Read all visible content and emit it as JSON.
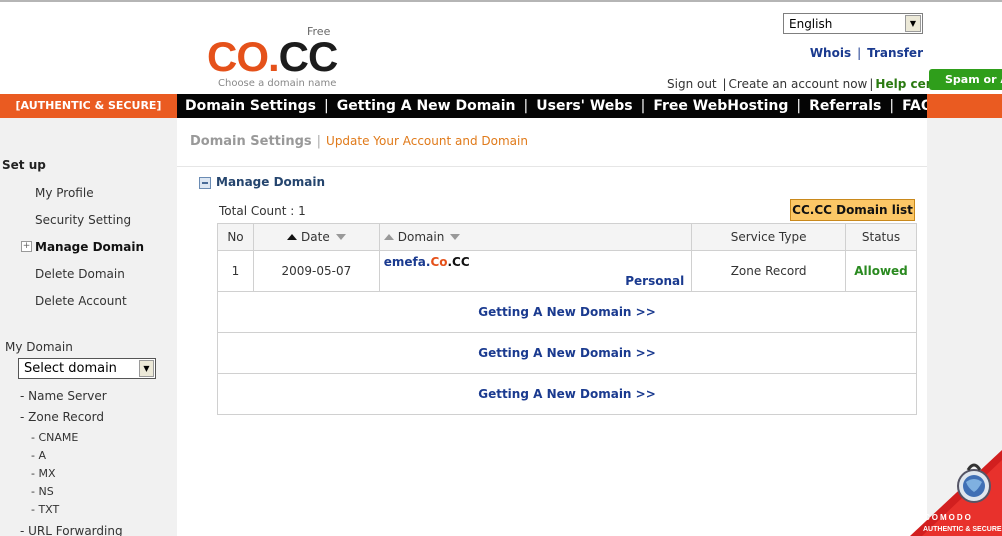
{
  "header": {
    "logo_free": "Free",
    "logo_co": "CO",
    "logo_dot": ".",
    "logo_cc": "CC",
    "logo_tagline": "Choose a domain name",
    "language": "English",
    "whois": "Whois",
    "transfer": "Transfer",
    "top_sep": "|",
    "sign_out": "Sign out",
    "create_account": "Create an account now",
    "help_center": "Help center",
    "account_sep": "|",
    "spam_badge": "Spam or A"
  },
  "nav": {
    "authentic": "[AUTHENTIC & SECURE]",
    "sep": "|",
    "items": [
      "Domain Settings",
      "Getting A New Domain",
      "Users' Webs",
      "Free WebHosting",
      "Referrals",
      "FAQ"
    ]
  },
  "sidebar": {
    "setup": "Set up",
    "items": [
      {
        "label": "My Profile"
      },
      {
        "label": "Security Setting"
      },
      {
        "label": "Manage Domain"
      },
      {
        "label": "Delete Domain"
      },
      {
        "label": "Delete Account"
      }
    ],
    "my_domain": "My Domain",
    "select_domain": "Select domain",
    "name_server": "- Name Server",
    "zone_record": "- Zone Record",
    "zone_items": [
      "- CNAME",
      "- A",
      "- MX",
      "- NS",
      "- TXT"
    ],
    "url_forwarding": "- URL Forwarding"
  },
  "main": {
    "crumb_main": "Domain Settings",
    "crumb_sep": "|",
    "crumb_sub": "Update Your Account and Domain",
    "section_title": "Manage Domain",
    "total_count": "Total Count : 1",
    "domain_list_button": "CC.CC Domain list",
    "columns": {
      "no": "No",
      "date": "Date",
      "domain": "Domain",
      "service_type": "Service Type",
      "status": "Status"
    },
    "rows": [
      {
        "no": "1",
        "date": "2009-05-07",
        "domain_prefix": "emefa.",
        "domain_co": "Co",
        "domain_suffix": ".CC",
        "plan": "Personal",
        "service_type": "Zone Record",
        "status": "Allowed"
      }
    ],
    "get_new_domain_links": [
      "Getting A New Domain >>",
      "Getting A New Domain >>",
      "Getting A New Domain >>"
    ]
  },
  "badge": {
    "comodo": "COMODO",
    "comodo_caption": "AUTHENTIC & SECURE"
  },
  "colors": {
    "brand_orange": "#ea5b21",
    "nav_black": "#050505",
    "link_blue": "#1a3a8f",
    "status_green": "#2a8a20"
  }
}
